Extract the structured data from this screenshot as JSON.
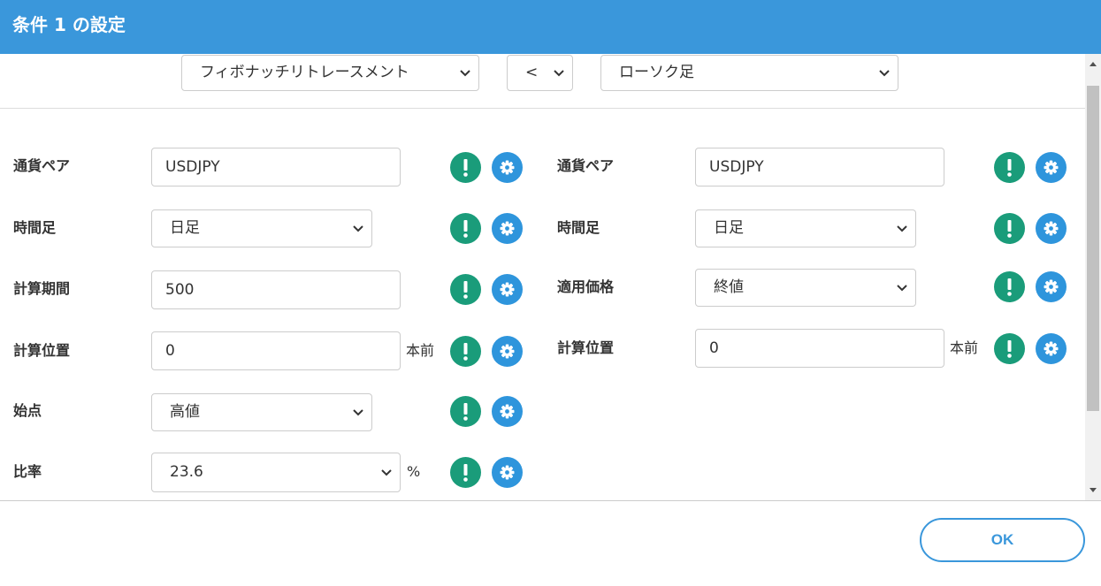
{
  "dialog": {
    "title": "条件 1 の設定"
  },
  "condition": {
    "left_indicator": "フィボナッチリトレースメント",
    "operator": "<",
    "right_indicator": "ローソク足"
  },
  "left_params": {
    "currency_pair": {
      "label": "通貨ペア",
      "value": "USDJPY"
    },
    "timeframe": {
      "label": "時間足",
      "value": "日足"
    },
    "period": {
      "label": "計算期間",
      "value": "500"
    },
    "position": {
      "label": "計算位置",
      "value": "0",
      "unit": "本前"
    },
    "start_point": {
      "label": "始点",
      "value": "高値"
    },
    "ratio": {
      "label": "比率",
      "value": "23.6",
      "unit": "%"
    }
  },
  "right_params": {
    "currency_pair": {
      "label": "通貨ペア",
      "value": "USDJPY"
    },
    "timeframe": {
      "label": "時間足",
      "value": "日足"
    },
    "applied_price": {
      "label": "適用価格",
      "value": "終値"
    },
    "position": {
      "label": "計算位置",
      "value": "0",
      "unit": "本前"
    }
  },
  "footer": {
    "ok_label": "OK"
  },
  "colors": {
    "header": "#3a97db",
    "info": "#1a9c7a",
    "gear": "#2e95dc"
  }
}
